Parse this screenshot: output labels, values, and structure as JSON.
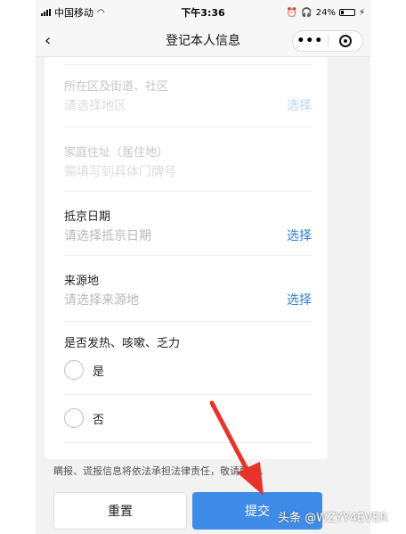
{
  "status_bar": {
    "carrier": "中国移动",
    "time": "下午3:36",
    "battery": "24%"
  },
  "navbar": {
    "back_icon": "‹",
    "title": "登记本人信息",
    "more_icon": "•••"
  },
  "form": {
    "district": {
      "label": "所在区及街道、社区",
      "placeholder": "请选择地区",
      "action": "选择"
    },
    "address": {
      "label": "家庭住址（居住地）",
      "placeholder": "需填写到具体门牌号"
    },
    "arrival_date": {
      "label": "抵京日期",
      "placeholder": "请选择抵京日期",
      "action": "选择"
    },
    "origin": {
      "label": "来源地",
      "placeholder": "请选择来源地",
      "action": "选择"
    },
    "symptoms": {
      "label": "是否发热、咳嗽、乏力",
      "options": [
        "是",
        "否"
      ]
    }
  },
  "notice": "瞒报、谎报信息将依法承担法律责任，敬请配合。",
  "buttons": {
    "reset": "重置",
    "submit": "提交"
  },
  "watermark": "头条 @WZYY4EVER",
  "colors": {
    "accent": "#3e8ce8",
    "link": "#2f7fd0",
    "annotation_arrow": "#e8332a"
  }
}
